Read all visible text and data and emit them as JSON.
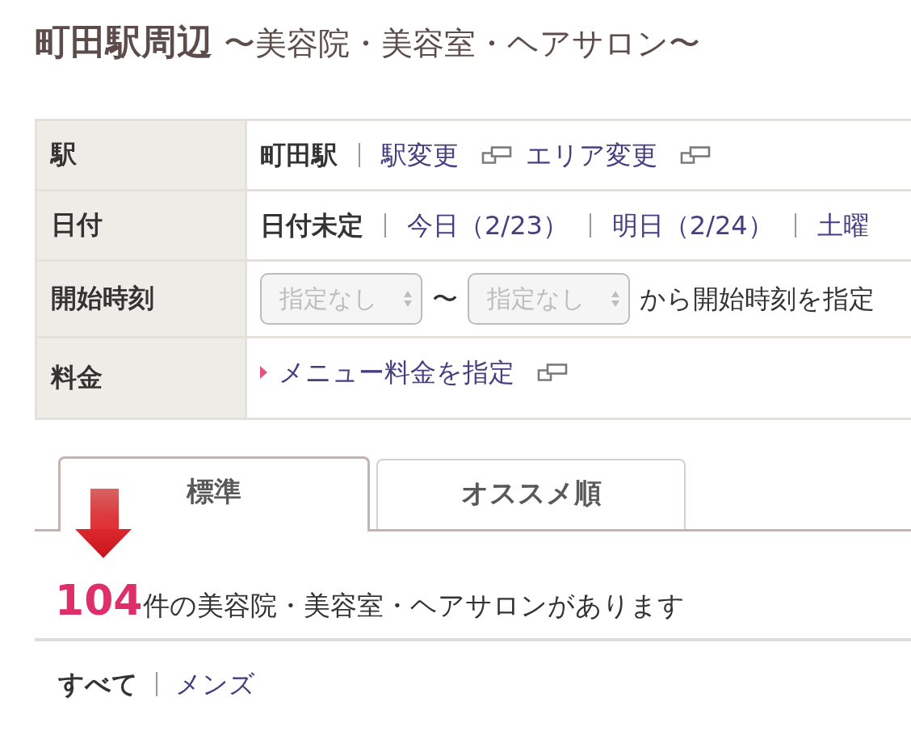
{
  "header": {
    "title": "町田駅周辺",
    "subtitle": "〜美容院・美容室・ヘアサロン〜"
  },
  "conditions": [
    {
      "kind": "station",
      "label": "駅",
      "current": "町田駅",
      "links": [
        {
          "label": "駅変更",
          "popup": true
        },
        {
          "label": "エリア変更",
          "popup": true
        }
      ]
    },
    {
      "kind": "options",
      "label": "日付",
      "options": [
        {
          "label": "日付未定",
          "selected": true
        },
        {
          "label": "今日（2/23）",
          "selected": false
        },
        {
          "label": "明日（2/24）",
          "selected": false
        },
        {
          "label": "土曜",
          "selected": false
        }
      ]
    },
    {
      "kind": "time_range",
      "label": "開始時刻",
      "from": {
        "value": "指定なし",
        "disabled": true
      },
      "separator": "〜",
      "to": {
        "value": "指定なし",
        "disabled": true
      },
      "note": "から開始時刻を指定"
    },
    {
      "kind": "link",
      "label": "料金",
      "link": {
        "label": "メニュー料金を指定",
        "popup": true
      }
    }
  ],
  "tabs": [
    {
      "label": "標準",
      "selected": true
    },
    {
      "label": "オススメ順",
      "selected": false
    }
  ],
  "result": {
    "count": "104",
    "text": "件の美容院・美容室・ヘアサロンがあります"
  },
  "filters": [
    {
      "label": "すべて",
      "selected": true
    },
    {
      "label": "メンズ",
      "selected": false
    }
  ]
}
